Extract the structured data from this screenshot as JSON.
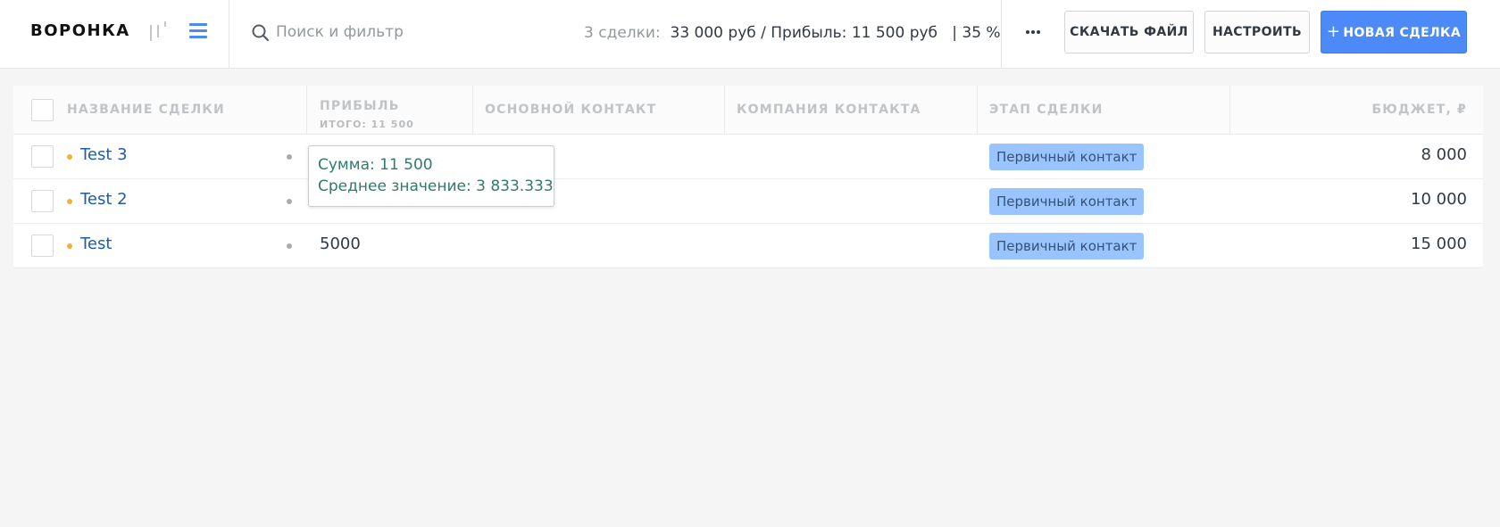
{
  "header": {
    "title": "ВОРОНКА",
    "search_placeholder": "Поиск и фильтр",
    "summary": {
      "count": "3 сделки:",
      "values": "33 000 руб / Прибыль: 11 500 руб",
      "percent": "| 35 %"
    },
    "download_label": "СКАЧАТЬ ФАЙЛ",
    "settings_label": "НАСТРОИТЬ",
    "new_deal_plus": "+",
    "new_deal_label": "НОВАЯ СДЕЛКА"
  },
  "colors": {
    "accent": "#4c8bf7",
    "stage_badge": "#99c4ff",
    "deal_link": "#1f5ca8",
    "status_dot": "#f2b132"
  },
  "icons": {
    "pipeline_view": "pipeline-view-icon",
    "list_view": "list-view-icon",
    "search": "search-icon",
    "more": "more-icon"
  },
  "table": {
    "columns": {
      "name": "НАЗВАНИЕ СДЕЛКИ",
      "profit": "ПРИБЫЛЬ",
      "profit_total": "ИТОГО: 11 500",
      "contact": "ОСНОВНОЙ КОНТАКТ",
      "company": "КОМПАНИЯ КОНТАКТА",
      "stage": "ЭТАП СДЕЛКИ",
      "budget": "БЮДЖЕТ, ₽"
    },
    "rows": [
      {
        "name": "Test 3",
        "profit": "",
        "contact": "",
        "company": "",
        "stage": "Первичный контакт",
        "budget": "8 000"
      },
      {
        "name": "Test 2",
        "profit": "",
        "contact": "",
        "company": "",
        "stage": "Первичный контакт",
        "budget": "10 000"
      },
      {
        "name": "Test",
        "profit": "5000",
        "contact": "",
        "company": "",
        "stage": "Первичный контакт",
        "budget": "15 000"
      }
    ]
  },
  "tooltip": {
    "sum": "Сумма: 11 500",
    "average": "Среднее значение: 3 833.333"
  }
}
